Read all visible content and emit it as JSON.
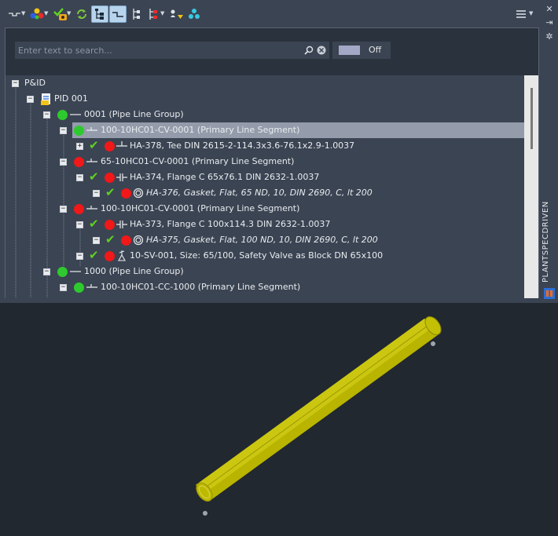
{
  "toolbar": {
    "buttons": [
      {
        "icon": "pipe-line-icon",
        "active": false
      },
      {
        "icon": "color-dots-icon",
        "active": false
      },
      {
        "icon": "check-status-icon",
        "active": false
      },
      {
        "icon": "refresh-icon",
        "active": false
      },
      {
        "icon": "tree-structure-icon",
        "active": true
      },
      {
        "icon": "segment-icon",
        "active": true
      },
      {
        "icon": "hierarchy-icon",
        "active": false
      },
      {
        "icon": "hierarchy-colored-icon",
        "active": false
      },
      {
        "icon": "person-marker-icon",
        "active": false
      },
      {
        "icon": "network-icon",
        "active": false
      }
    ],
    "menu_icon": "hamburger-menu-icon"
  },
  "search": {
    "placeholder": "Enter text to search...",
    "value": ""
  },
  "toggle": {
    "label": "Off",
    "state": "off",
    "color": "#a3a8c6"
  },
  "tree": {
    "rows": [
      {
        "label": "P&ID",
        "italic": false,
        "selected": false
      },
      {
        "label": "PID 001",
        "italic": false,
        "selected": false
      },
      {
        "label": "0001 (Pipe Line Group)",
        "italic": false,
        "selected": false
      },
      {
        "label": "100-10HC01-CV-0001 (Primary Line Segment)",
        "italic": false,
        "selected": true
      },
      {
        "label": "HA-378, Tee DIN 2615-2-114.3x3.6-76.1x2.9-1.0037",
        "italic": false,
        "selected": false
      },
      {
        "label": "65-10HC01-CV-0001 (Primary Line Segment)",
        "italic": false,
        "selected": false
      },
      {
        "label": "HA-374, Flange C 65x76.1 DIN 2632-1.0037",
        "italic": false,
        "selected": false
      },
      {
        "label": "HA-376, Gasket, Flat, 65 ND, 10, DIN 2690, C, lt 200",
        "italic": true,
        "selected": false
      },
      {
        "label": "100-10HC01-CV-0001 (Primary Line Segment)",
        "italic": false,
        "selected": false
      },
      {
        "label": "HA-373, Flange C 100x114.3 DIN 2632-1.0037",
        "italic": false,
        "selected": false
      },
      {
        "label": "HA-375, Gasket, Flat, 100 ND, 10, DIN 2690, C, lt 200",
        "italic": true,
        "selected": false
      },
      {
        "label": "10-SV-001, Size: 65/100, Safety Valve as Block DN 65x100",
        "italic": false,
        "selected": false
      },
      {
        "label": "1000 (Pipe Line Group)",
        "italic": false,
        "selected": false
      },
      {
        "label": "100-10HC01-CC-1000 (Primary Line Segment)",
        "italic": false,
        "selected": false
      }
    ]
  },
  "side_panel": {
    "label": "PLANTSPECDRIVEN",
    "buttons": [
      "close-icon",
      "collapse-icon",
      "settings-icon"
    ],
    "app_icon": "plantspec-app-icon"
  },
  "colors": {
    "status_ok": "#2ec92e",
    "status_error": "#f01818",
    "check": "#5fd31e",
    "pipe": "#c8c600",
    "selection": "#949cab"
  }
}
